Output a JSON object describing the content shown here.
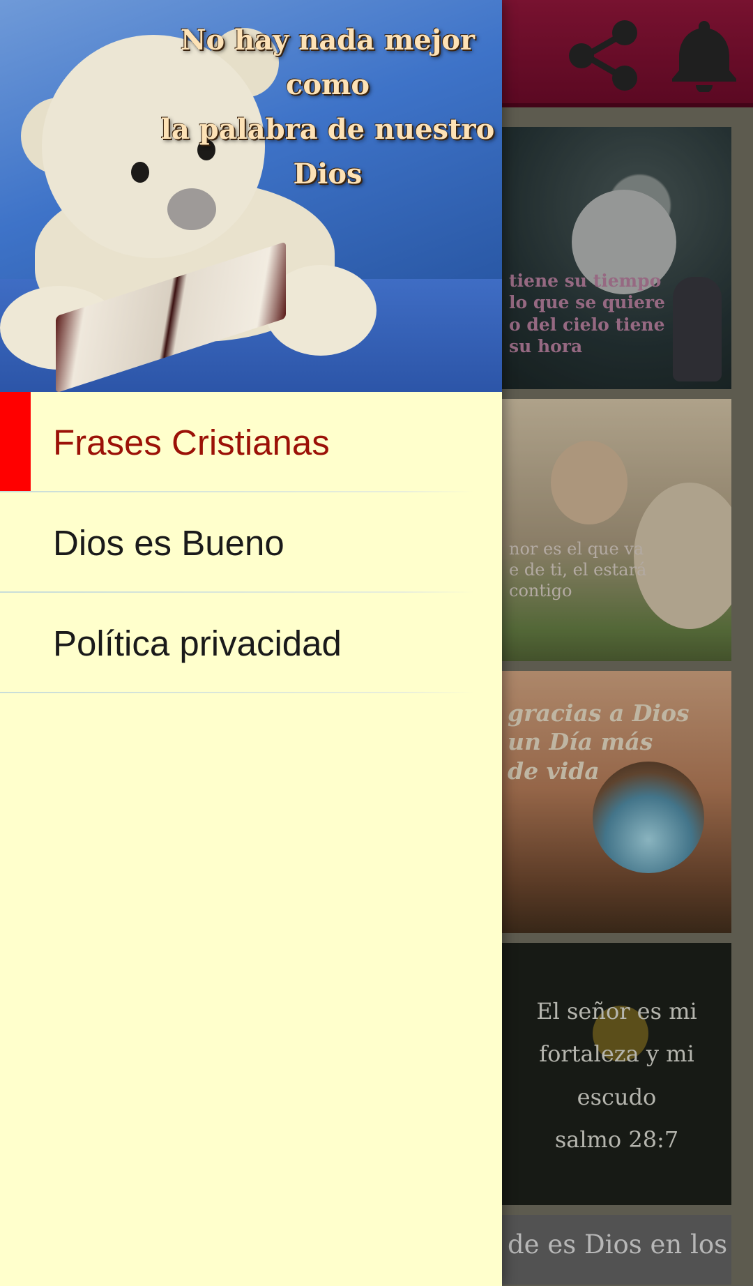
{
  "app_bar": {
    "background_color": "#8c1235",
    "share_icon": "share-icon",
    "notifications_icon": "bell-icon"
  },
  "cards": [
    {
      "text": "tiene su tiempo\nlo que se quiere\no del cielo tiene\nsu hora"
    },
    {
      "text": "nor es el que va\ne de ti, el estará\ncontigo"
    },
    {
      "text": "gracias a Dios\nun Día más\nde vida"
    },
    {
      "text": "El señor es mi\nfortaleza y mi\nescudo\nsalmo 28:7"
    },
    {
      "text": "de es Dios en los"
    }
  ],
  "drawer": {
    "background_color": "#ffffcc",
    "header": {
      "quote": "No hay nada mejor como\nla palabra de nuestro\nDios"
    },
    "menu": [
      {
        "label": "Frases Cristianas",
        "active": true
      },
      {
        "label": "Dios es Bueno",
        "active": false
      },
      {
        "label": "Política privacidad",
        "active": false
      }
    ],
    "active_color": "#9b1107",
    "active_indicator_color": "#ff0000"
  }
}
